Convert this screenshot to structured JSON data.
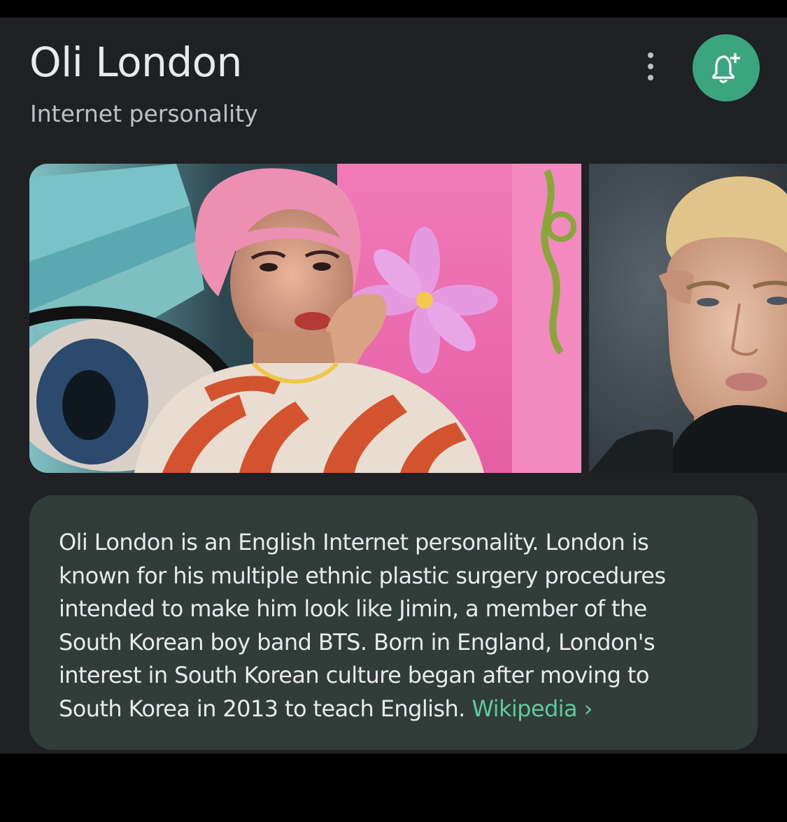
{
  "entity": {
    "title": "Oli London",
    "subtitle": "Internet personality"
  },
  "actions": {
    "more_icon": "more-vert-icon",
    "follow_icon": "bell-plus-icon",
    "accent_color": "#3aa57e"
  },
  "images": [
    {
      "icon": "photo-pink-hair"
    },
    {
      "icon": "photo-blonde-portrait"
    }
  ],
  "description": {
    "lines": [
      "Oli London is an English Internet personality. London is",
      "known for his multiple ethnic plastic surgery procedures",
      "intended to make him look like Jimin, a member of the",
      "South Korean boy band BTS. Born in England, London's",
      "interest in South Korean culture began after moving to",
      "South Korea in 2013 to teach English."
    ],
    "source_label": "Wikipedia",
    "source_chevron": "›",
    "link_color": "#5fc9a0"
  }
}
